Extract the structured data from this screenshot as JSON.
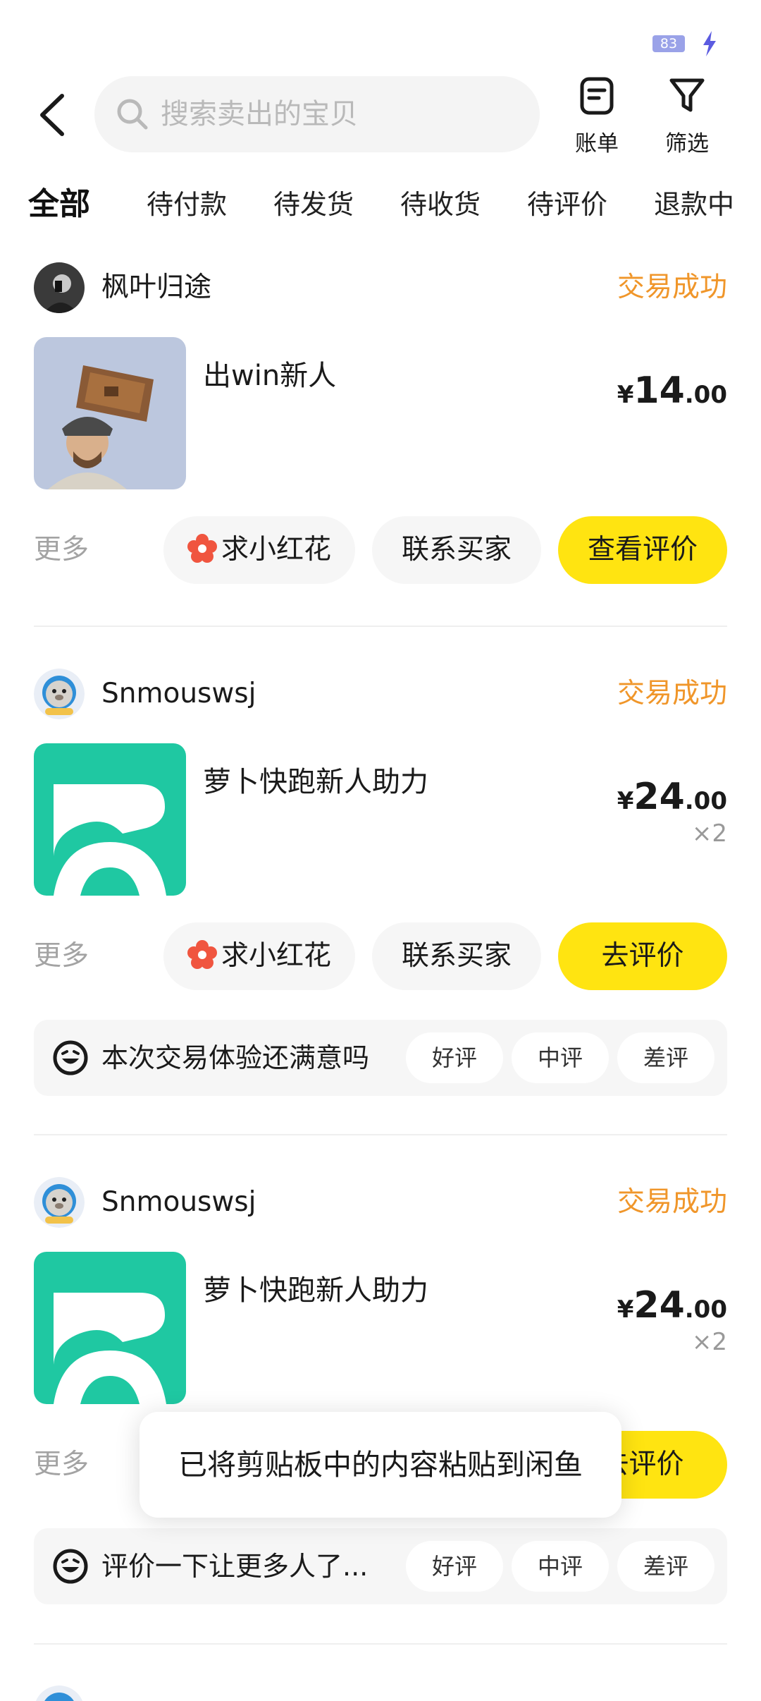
{
  "status_bar": {
    "battery": "83"
  },
  "header": {
    "search_placeholder": "搜索卖出的宝贝",
    "bill_label": "账单",
    "filter_label": "筛选"
  },
  "tabs": [
    "全部",
    "待付款",
    "待发货",
    "待收货",
    "待评价",
    "退款中"
  ],
  "active_tab": "全部",
  "colors": {
    "accent": "#ffe411",
    "status": "#f0962a",
    "thumb_green": "#1fc8a2"
  },
  "orders": [
    {
      "seller": "枫叶归途",
      "status": "交易成功",
      "title": "出win新人",
      "price_currency": "¥",
      "price_int": "14",
      "price_dec": ".00",
      "quantity": "",
      "more": "更多",
      "flower_btn": "求小红花",
      "contact_btn": "联系买家",
      "primary_btn": "查看评价"
    },
    {
      "seller": "Snmouswsj",
      "status": "交易成功",
      "title": "萝卜快跑新人助力",
      "price_currency": "¥",
      "price_int": "24",
      "price_dec": ".00",
      "quantity": "×2",
      "more": "更多",
      "flower_btn": "求小红花",
      "contact_btn": "联系买家",
      "primary_btn": "去评价",
      "review_prompt": "本次交易体验还满意吗",
      "review_good": "好评",
      "review_mid": "中评",
      "review_bad": "差评"
    },
    {
      "seller": "Snmouswsj",
      "status": "交易成功",
      "title": "萝卜快跑新人助力",
      "price_currency": "¥",
      "price_int": "24",
      "price_dec": ".00",
      "quantity": "×2",
      "more": "更多",
      "primary_btn": "去评价",
      "review_prompt": "评价一下让更多人了...",
      "review_good": "好评",
      "review_mid": "中评",
      "review_bad": "差评"
    }
  ],
  "toast": "已将剪贴板中的内容粘贴到闲鱼"
}
